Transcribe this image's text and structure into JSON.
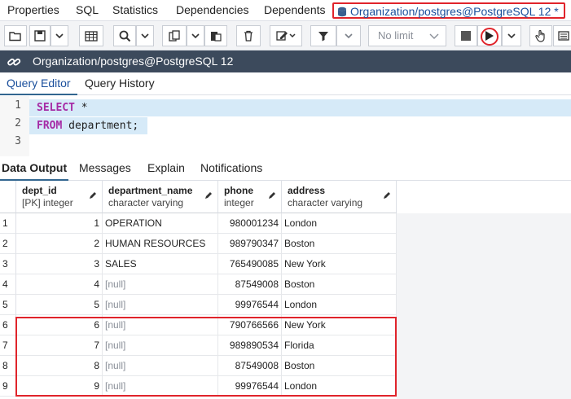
{
  "top_tabs": [
    "Properties",
    "SQL",
    "Statistics",
    "Dependencies",
    "Dependents"
  ],
  "active_query_tab": "Organization/postgres@PostgreSQL 12 *",
  "toolbar": {
    "limit_label": "No limit",
    "icons": [
      "open-file-icon",
      "save-icon",
      "chevron-down-icon",
      "grid-icon",
      "find-icon",
      "copy-icon",
      "paste-icon",
      "delete-icon",
      "edit-icon",
      "filter-icon",
      "stop-icon",
      "execute-icon",
      "hand-icon",
      "explain-icon"
    ]
  },
  "connection": {
    "label": "Organization/postgres@PostgreSQL 12"
  },
  "editor_tabs": [
    "Query Editor",
    "Query History"
  ],
  "editor": {
    "line_numbers": [
      "1",
      "2",
      "3"
    ],
    "lines": [
      {
        "keyword": "SELECT",
        "rest": " *"
      },
      {
        "keyword": "FROM",
        "rest": " department;"
      },
      {
        "keyword": "",
        "rest": ""
      }
    ]
  },
  "output_tabs": [
    "Data Output",
    "Messages",
    "Explain",
    "Notifications"
  ],
  "grid": {
    "columns": [
      {
        "name": "dept_id",
        "type": "[PK] integer"
      },
      {
        "name": "department_name",
        "type": "character varying"
      },
      {
        "name": "phone",
        "type": "integer"
      },
      {
        "name": "address",
        "type": "character varying"
      }
    ],
    "rows": [
      {
        "idx": "1",
        "dept_id": "1",
        "department_name": "OPERATION",
        "phone": "980001234",
        "address": "London"
      },
      {
        "idx": "2",
        "dept_id": "2",
        "department_name": "HUMAN RESOURCES",
        "phone": "989790347",
        "address": "Boston"
      },
      {
        "idx": "3",
        "dept_id": "3",
        "department_name": "SALES",
        "phone": "765490085",
        "address": "New York"
      },
      {
        "idx": "4",
        "dept_id": "4",
        "department_name": "[null]",
        "phone": "87549008",
        "address": "Boston"
      },
      {
        "idx": "5",
        "dept_id": "5",
        "department_name": "[null]",
        "phone": "99976544",
        "address": "London"
      },
      {
        "idx": "6",
        "dept_id": "6",
        "department_name": "[null]",
        "phone": "790766566",
        "address": "New York"
      },
      {
        "idx": "7",
        "dept_id": "7",
        "department_name": "[null]",
        "phone": "989890534",
        "address": "Florida"
      },
      {
        "idx": "8",
        "dept_id": "8",
        "department_name": "[null]",
        "phone": "87549008",
        "address": "Boston"
      },
      {
        "idx": "9",
        "dept_id": "9",
        "department_name": "[null]",
        "phone": "99976544",
        "address": "London"
      }
    ]
  },
  "colors": {
    "highlight_red": "#e0242b",
    "header_dark": "#3c4a5c",
    "keyword": "#a52aa5",
    "active_tab": "#1a4f9c"
  }
}
